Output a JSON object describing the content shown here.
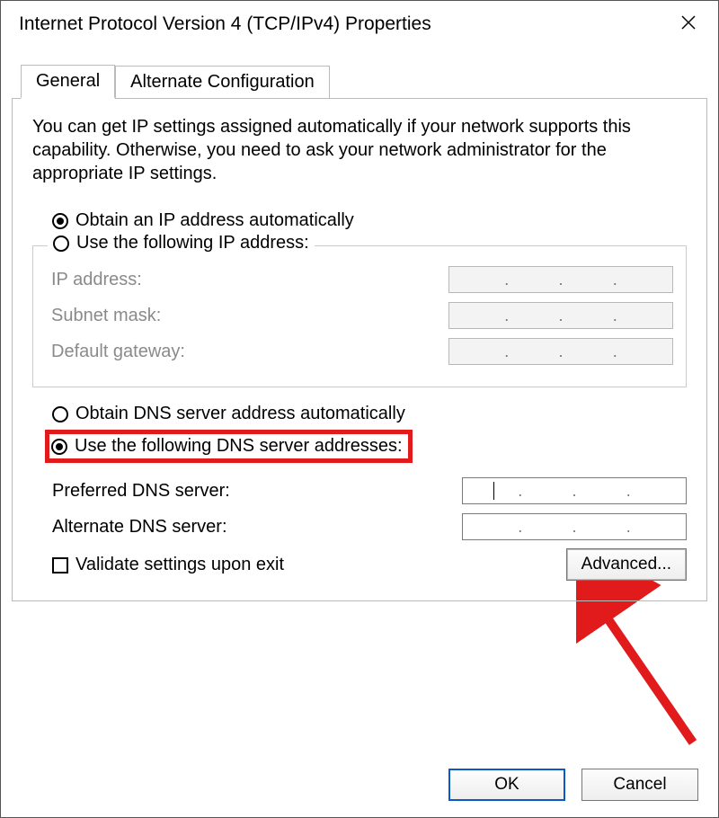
{
  "window": {
    "title": "Internet Protocol Version 4 (TCP/IPv4) Properties"
  },
  "tabs": {
    "general": "General",
    "alternate": "Alternate Configuration"
  },
  "description": "You can get IP settings assigned automatically if your network supports this capability. Otherwise, you need to ask your network administrator for the appropriate IP settings.",
  "ip": {
    "obtain_auto": "Obtain an IP address automatically",
    "use_following": "Use the following IP address:",
    "ip_label": "IP address:",
    "subnet_label": "Subnet mask:",
    "gateway_label": "Default gateway:"
  },
  "dns": {
    "obtain_auto": "Obtain DNS server address automatically",
    "use_following": "Use the following DNS server addresses:",
    "preferred_label": "Preferred DNS server:",
    "alternate_label": "Alternate DNS server:"
  },
  "validate_label": "Validate settings upon exit",
  "buttons": {
    "advanced": "Advanced...",
    "ok": "OK",
    "cancel": "Cancel"
  },
  "dots": {
    "d": "."
  }
}
